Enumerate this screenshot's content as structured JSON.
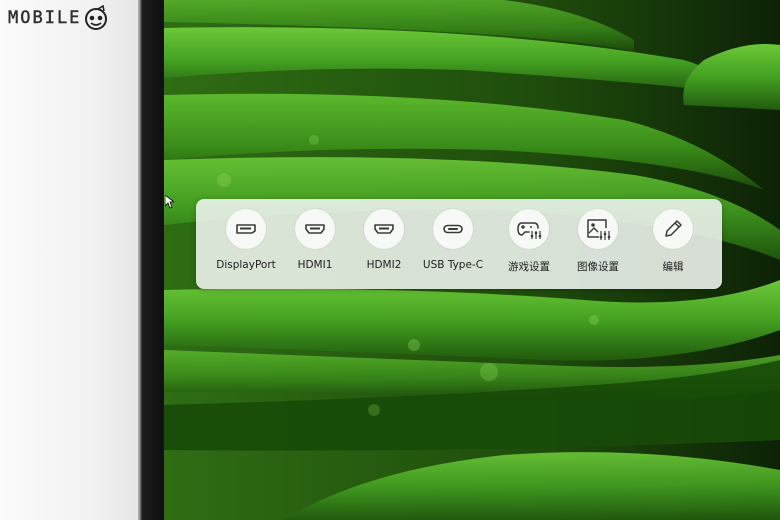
{
  "watermark": {
    "text": "MOBILE",
    "logo_icon": "mascot-face-icon"
  },
  "colors": {
    "osd_bg": "#ecf2ec",
    "leaf_green": "#3f9a1e",
    "icon_stroke": "#3a3a3a"
  },
  "osd": {
    "items": [
      {
        "label": "DisplayPort",
        "icon": "displayport-icon"
      },
      {
        "label": "HDMI1",
        "icon": "hdmi-icon"
      },
      {
        "label": "HDMI2",
        "icon": "hdmi-icon"
      },
      {
        "label": "USB Type-C",
        "icon": "usb-c-icon"
      },
      {
        "label": "游戏设置",
        "icon": "gamepad-settings-icon"
      },
      {
        "label": "图像设置",
        "icon": "image-settings-icon"
      },
      {
        "label": "编辑",
        "icon": "pencil-edit-icon"
      }
    ]
  }
}
